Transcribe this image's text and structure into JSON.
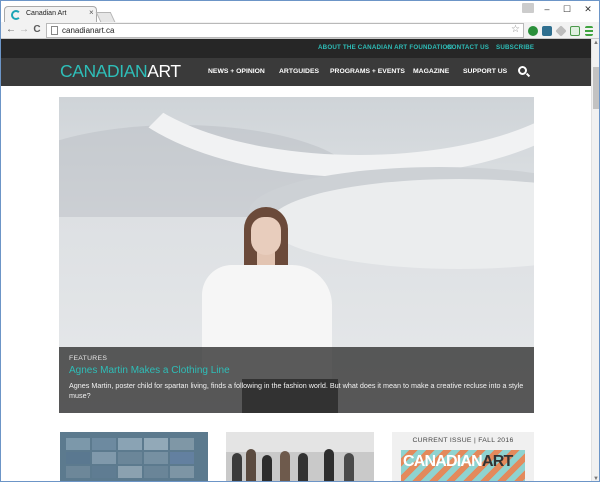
{
  "browser": {
    "tab_title": "Canadian Art",
    "tab_close": "×",
    "url": "canadianart.ca",
    "controls": {
      "minimize": "–",
      "maximize": "☐",
      "close": "✕"
    },
    "nav": {
      "back": "←",
      "forward": "→",
      "reload": "C"
    },
    "star": "☆"
  },
  "site": {
    "utility_links": [
      "ABOUT THE CANADIAN ART FOUNDATION",
      "CONTACT US",
      "SUBSCRIBE"
    ],
    "logo": {
      "part1": "CANADIAN",
      "part2": "ART"
    },
    "nav_items": [
      "NEWS + OPINION",
      "ARTGUIDES",
      "PROGRAMS + EVENTS",
      "MAGAZINE",
      "SUPPORT US"
    ],
    "hero": {
      "label": "FEATURES",
      "title": "Agnes Martin Makes a Clothing Line",
      "description": "Agnes Martin, poster child for spartan living, finds a following in the fashion world. But what does it mean to make a creative recluse into a style muse?"
    },
    "current_issue": {
      "label": "CURRENT ISSUE | FALL 2016",
      "cover_logo": {
        "part1": "CANADIAN",
        "part2": "ART"
      }
    }
  },
  "colors": {
    "accent": "#2ebeb8",
    "utility_bar": "#262626",
    "nav_bar": "#3a3a3a"
  },
  "icons": [
    "search-icon",
    "star-icon",
    "page-icon",
    "favicon-icon"
  ]
}
